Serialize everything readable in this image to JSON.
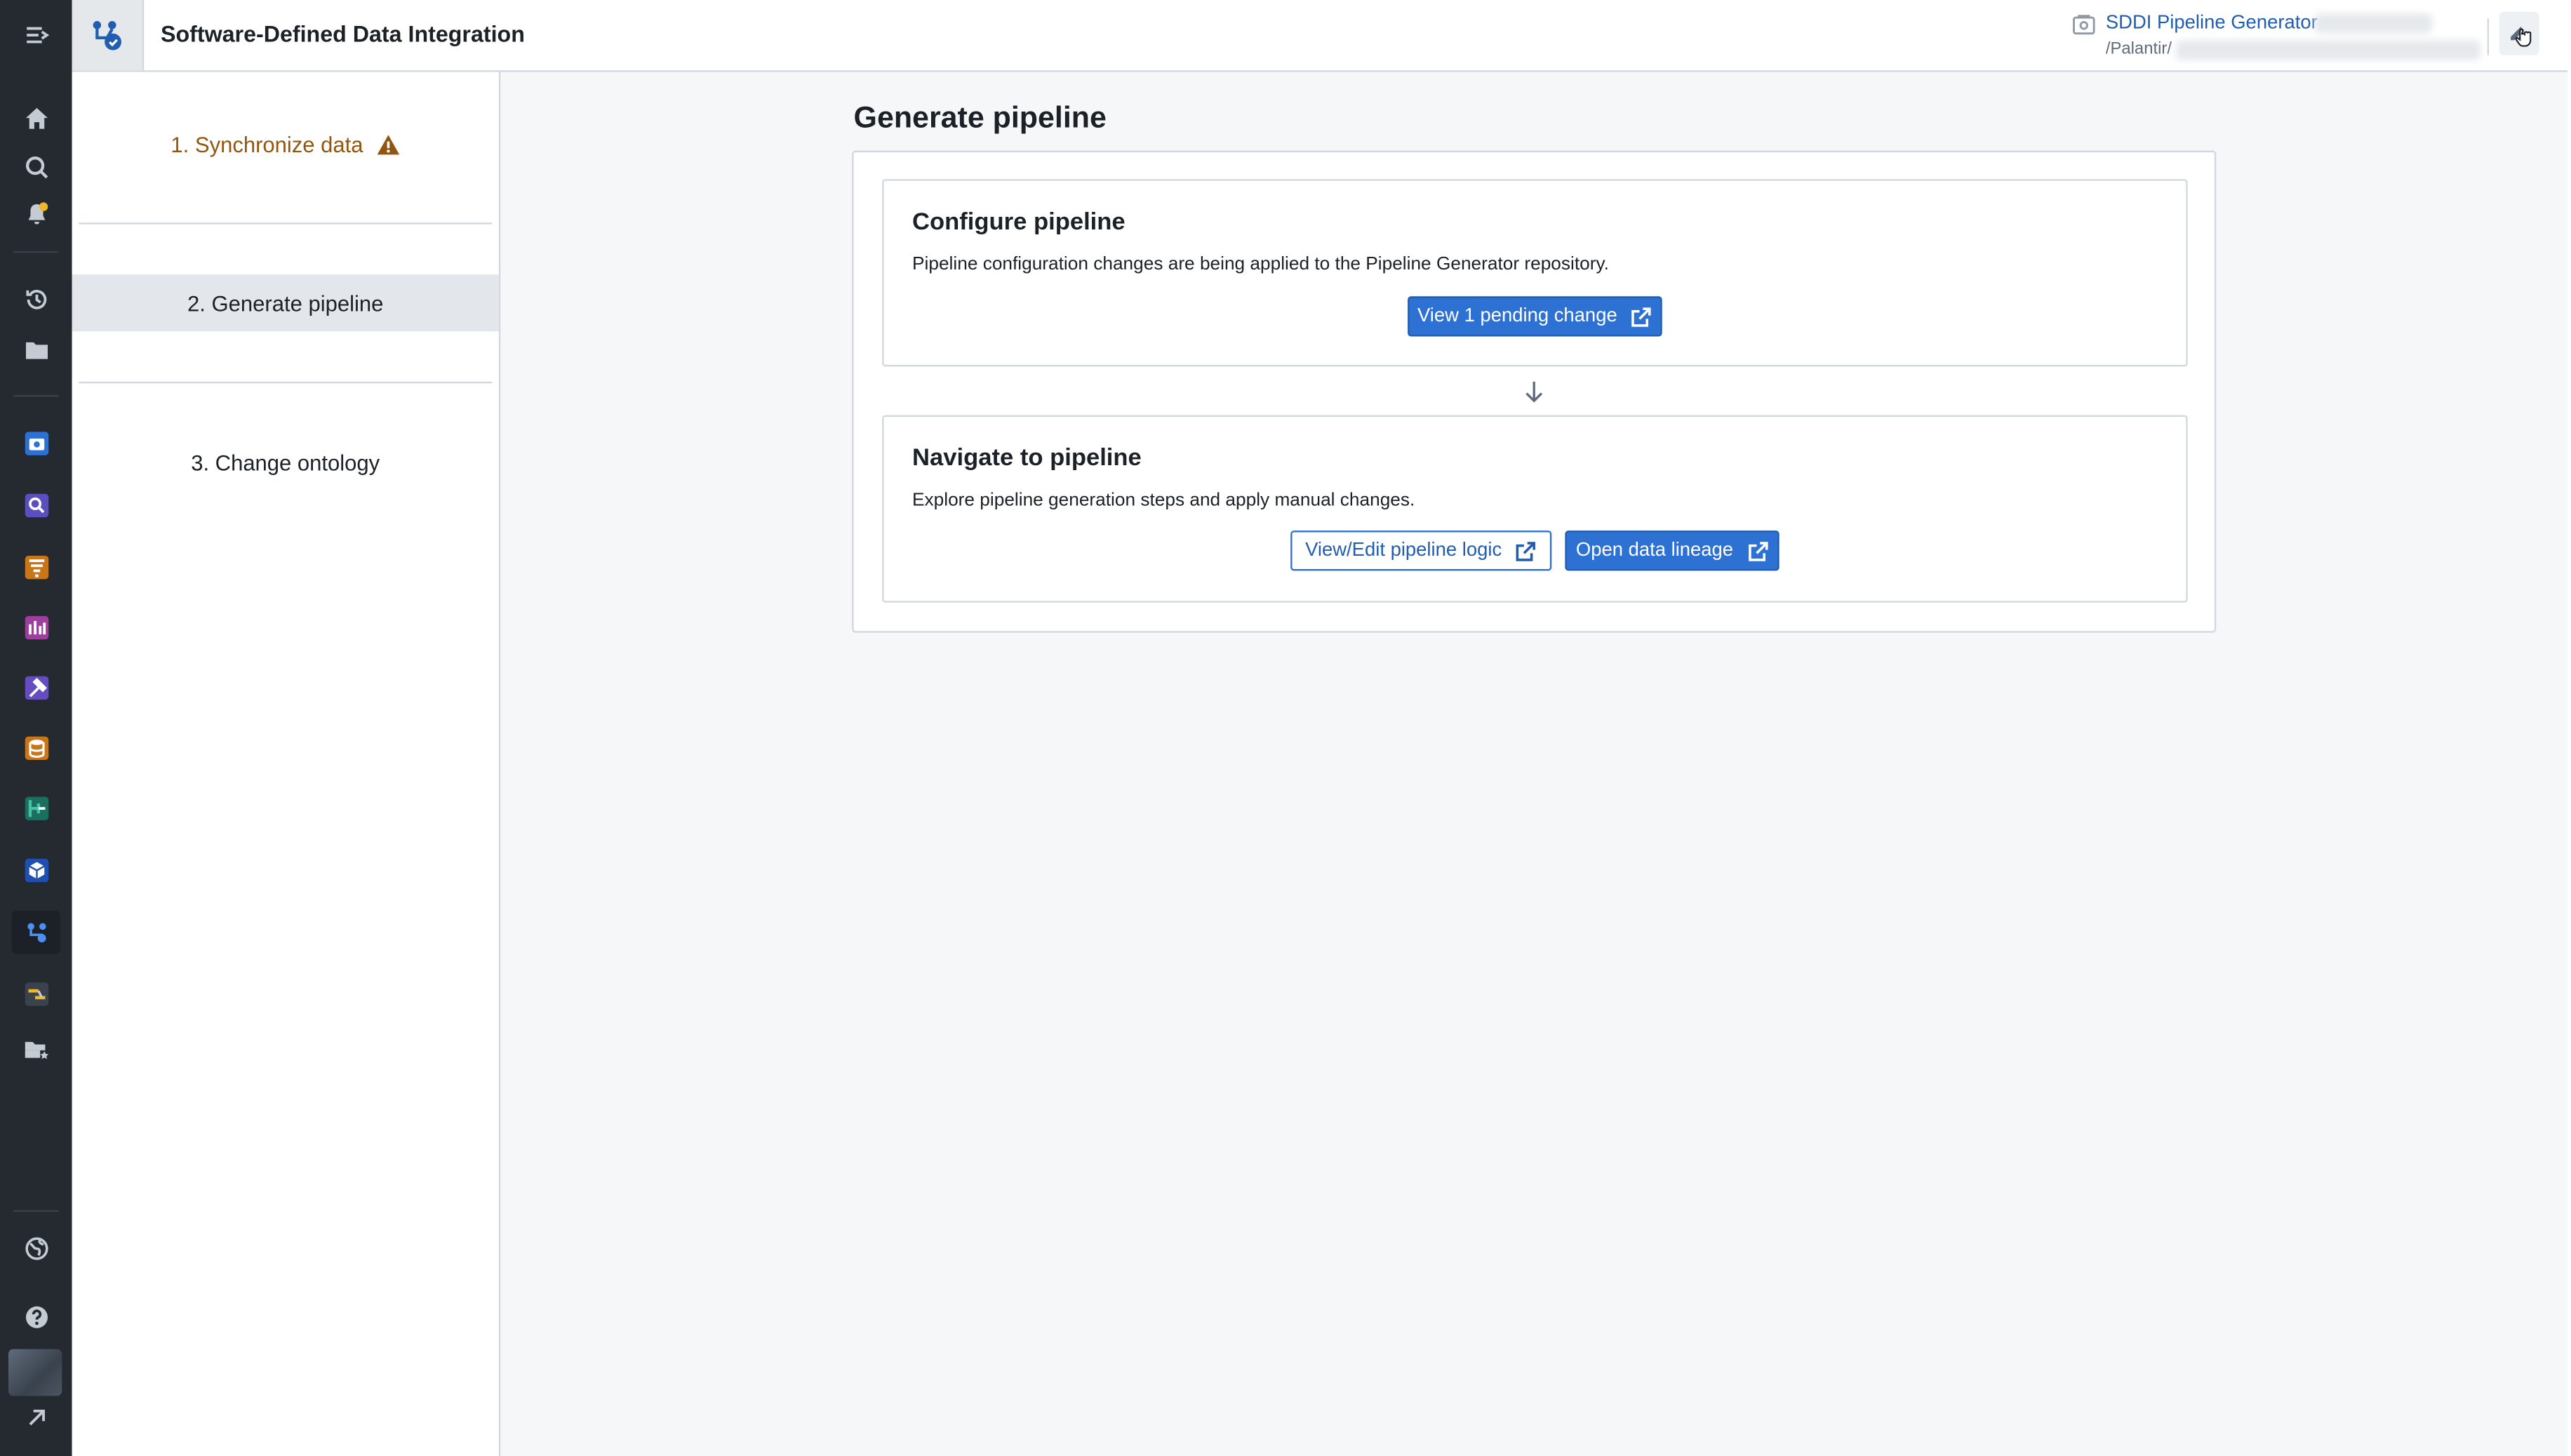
{
  "header": {
    "app_title": "Software-Defined Data Integration",
    "resource_name": "SDDI Pipeline Generator",
    "resource_path": "/Palantir/"
  },
  "steps": [
    {
      "label": "1. Synchronize data",
      "status": "warning"
    },
    {
      "label": "2. Generate pipeline",
      "status": "active"
    },
    {
      "label": "3. Change ontology",
      "status": "default"
    }
  ],
  "main": {
    "title": "Generate pipeline",
    "configure": {
      "title": "Configure pipeline",
      "description": "Pipeline configuration changes are being applied to the Pipeline Generator repository.",
      "button_label": "View 1 pending change"
    },
    "navigate": {
      "title": "Navigate to pipeline",
      "description": "Explore pipeline generation steps and apply manual changes.",
      "edit_button_label": "View/Edit pipeline logic",
      "lineage_button_label": "Open data lineage"
    }
  },
  "colors": {
    "primary": "#2d72d2",
    "link": "#215db0",
    "warning": "#935610",
    "rail": "#252a31"
  },
  "icons": {
    "rail": [
      "menu-icon",
      "home-icon",
      "search-icon",
      "notifications-icon",
      "history-icon",
      "folder-icon",
      "camera-app-icon",
      "object-search-icon",
      "filter-app-icon",
      "chart-app-icon",
      "hammer-app-icon",
      "database-app-icon",
      "pipeline-app-icon",
      "cube-app-icon",
      "sddi-app-icon",
      "flow-app-icon",
      "folder-star-icon",
      "globe-icon",
      "help-icon",
      "arrow-up-right-icon"
    ]
  }
}
